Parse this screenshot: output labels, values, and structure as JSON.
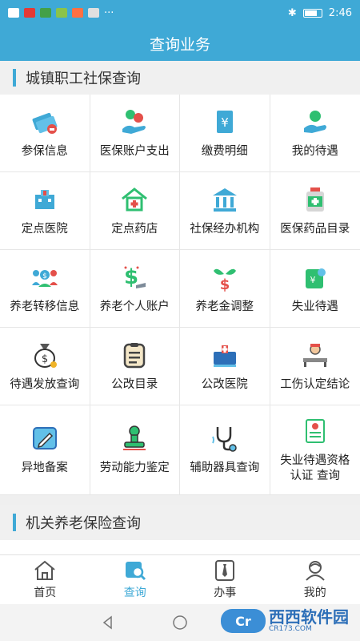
{
  "status_bar": {
    "time": "2:46",
    "dots": "···"
  },
  "header": {
    "title": "查询业务"
  },
  "section1": {
    "title": "城镇职工社保查询"
  },
  "items": [
    {
      "label": "参保信息",
      "icon": "insurance-card-icon"
    },
    {
      "label": "医保账户支出",
      "icon": "hand-coins-icon"
    },
    {
      "label": "缴费明细",
      "icon": "yuan-document-icon"
    },
    {
      "label": "我的待遇",
      "icon": "hand-gift-icon"
    },
    {
      "label": "定点医院",
      "icon": "hospital-building-icon"
    },
    {
      "label": "定点药店",
      "icon": "pharmacy-house-icon"
    },
    {
      "label": "社保经办机构",
      "icon": "government-building-icon"
    },
    {
      "label": "医保药品目录",
      "icon": "medicine-bottle-icon"
    },
    {
      "label": "养老转移信息",
      "icon": "people-transfer-icon"
    },
    {
      "label": "养老个人账户",
      "icon": "dollar-account-icon"
    },
    {
      "label": "养老金调整",
      "icon": "money-plant-icon"
    },
    {
      "label": "失业待遇",
      "icon": "unemployment-card-icon"
    },
    {
      "label": "待遇发放查询",
      "icon": "money-bag-icon"
    },
    {
      "label": "公改目录",
      "icon": "clipboard-list-icon"
    },
    {
      "label": "公改医院",
      "icon": "hospital-bed-icon"
    },
    {
      "label": "工伤认定结论",
      "icon": "injured-person-icon"
    },
    {
      "label": "异地备案",
      "icon": "pencil-note-icon"
    },
    {
      "label": "劳动能力鉴定",
      "icon": "stamp-icon"
    },
    {
      "label": "辅助器具查询",
      "icon": "stethoscope-icon"
    },
    {
      "label": "失业待遇资格\n认证 查询",
      "icon": "certificate-icon"
    }
  ],
  "section2": {
    "title": "机关养老保险查询"
  },
  "bottom_nav": [
    {
      "label": "首页",
      "icon": "home-icon"
    },
    {
      "label": "查询",
      "icon": "search-tab-icon"
    },
    {
      "label": "办事",
      "icon": "tie-icon"
    },
    {
      "label": "我的",
      "icon": "user-icon"
    }
  ],
  "watermark": {
    "logo_text": "Cr",
    "title": "西西软件园",
    "sub": "CR173.COM"
  },
  "colors": {
    "primary": "#3fa9d6",
    "accent_green": "#2fbf71",
    "accent_red": "#e4504a"
  }
}
